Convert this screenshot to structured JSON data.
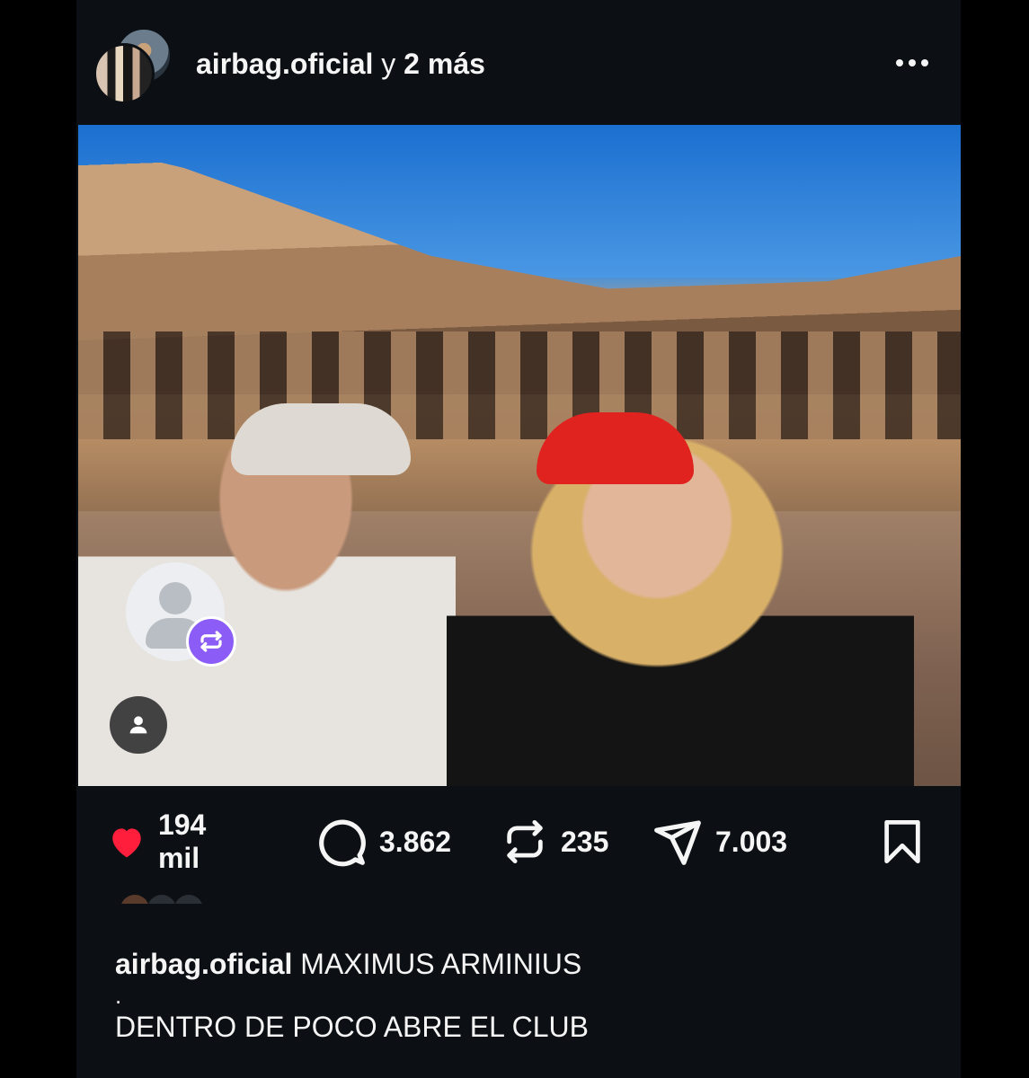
{
  "post": {
    "author": "airbag.oficial",
    "collab_connector": "y",
    "collab_more": "2 más",
    "more_options_icon": "more-horizontal-icon"
  },
  "photo": {
    "tag_icon": "person-tag-icon",
    "repost_badge_color": "#8b5cf6"
  },
  "actions": {
    "like_count": "194 mil",
    "comment_count": "3.862",
    "repost_count": "235",
    "share_count": "7.003",
    "like_color": "#ff3040"
  },
  "caption": {
    "author": "airbag.oficial",
    "line1": "MAXIMUS ARMINIUS",
    "line2": ".",
    "line3": "DENTRO DE POCO ABRE EL CLUB"
  }
}
